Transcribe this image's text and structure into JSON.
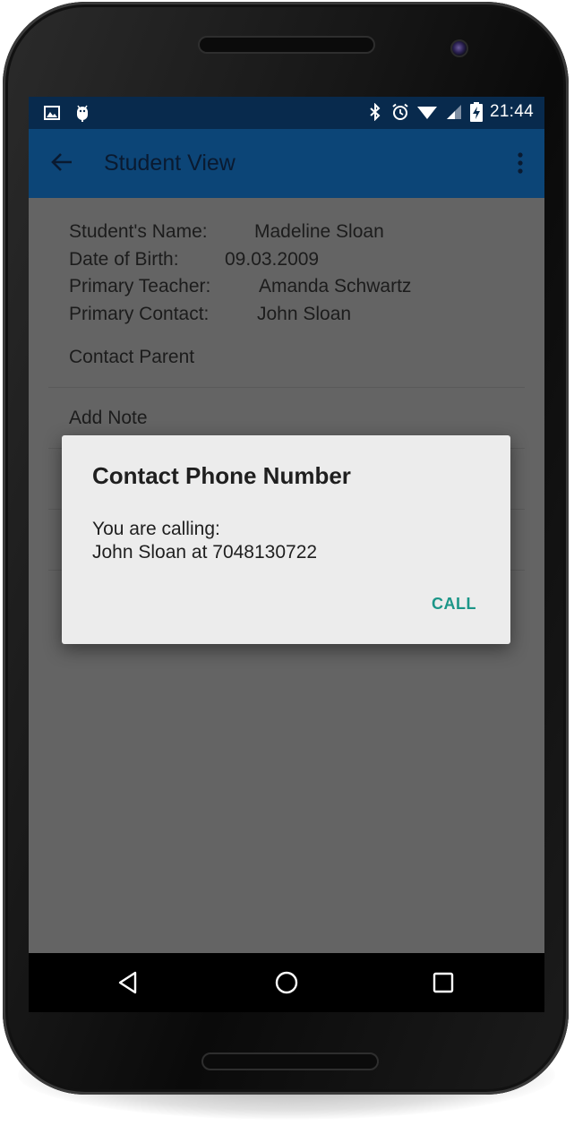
{
  "status_bar": {
    "time": "21:44",
    "icons": [
      "image-icon",
      "android-debug-icon",
      "bluetooth-icon",
      "alarm-icon",
      "wifi-icon",
      "signal-icon",
      "battery-charging-icon"
    ]
  },
  "app_bar": {
    "title": "Student View",
    "back_icon": "arrow-back-icon",
    "menu_icon": "more-vert-icon",
    "color": "#0c4577"
  },
  "student": {
    "name_label": "Student's Name:",
    "name_value": "Madeline Sloan",
    "dob_label": "Date of Birth:",
    "dob_value": "09.03.2009",
    "teacher_label": "Primary Teacher:",
    "teacher_value": "Amanda Schwartz",
    "contact_label": "Primary Contact:",
    "contact_value": "John Sloan"
  },
  "menu": {
    "items": [
      "Contact Parent",
      "Add Note"
    ]
  },
  "dialog": {
    "title": "Contact Phone Number",
    "line1": "You are calling:",
    "line2": "John Sloan at 7048130722",
    "call_label": "CALL",
    "accent": "#1c9688"
  },
  "nav_bar": {
    "icons": [
      "back-triangle-icon",
      "home-circle-icon",
      "recents-square-icon"
    ]
  }
}
